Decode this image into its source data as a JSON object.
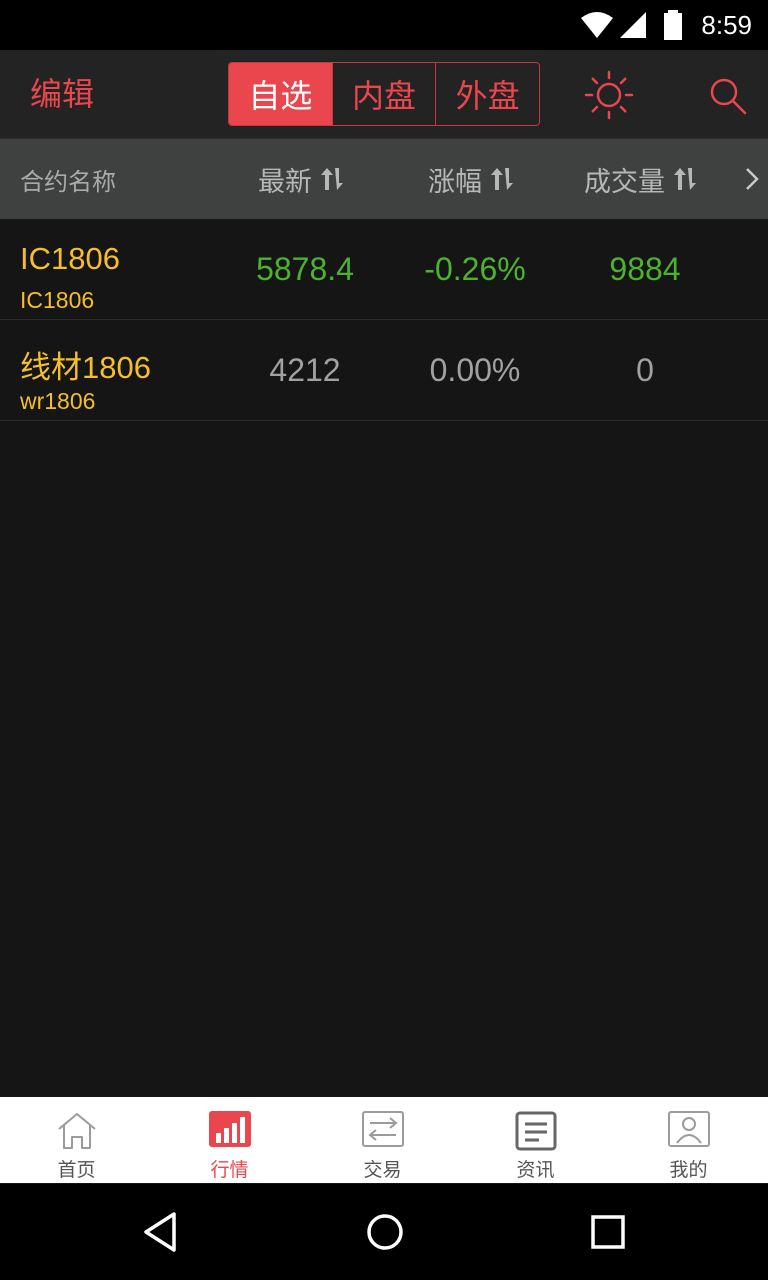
{
  "status_bar": {
    "time": "8:59"
  },
  "app_bar": {
    "edit_label": "编辑",
    "tabs": [
      {
        "label": "自选",
        "active": true
      },
      {
        "label": "内盘",
        "active": false
      },
      {
        "label": "外盘",
        "active": false
      }
    ],
    "accent_color": "#e9464d"
  },
  "table": {
    "columns": [
      {
        "label": "合约名称"
      },
      {
        "label": "最新"
      },
      {
        "label": "涨幅"
      },
      {
        "label": "成交量"
      }
    ],
    "rows": [
      {
        "name": "IC1806",
        "code": "IC1806",
        "last": "5878.4",
        "change": "-0.26%",
        "volume": "9884",
        "color": "#4db22d"
      },
      {
        "name": "线材1806",
        "code": "wr1806",
        "last": "4212",
        "change": "0.00%",
        "volume": "0",
        "color": "#a0a1a1"
      }
    ]
  },
  "bottom_tabs": [
    {
      "label": "首页",
      "icon": "home-icon"
    },
    {
      "label": "行情",
      "icon": "market-chart-icon",
      "active": true
    },
    {
      "label": "交易",
      "icon": "trade-exchange-icon"
    },
    {
      "label": "资讯",
      "icon": "news-icon"
    },
    {
      "label": "我的",
      "icon": "profile-icon"
    }
  ]
}
